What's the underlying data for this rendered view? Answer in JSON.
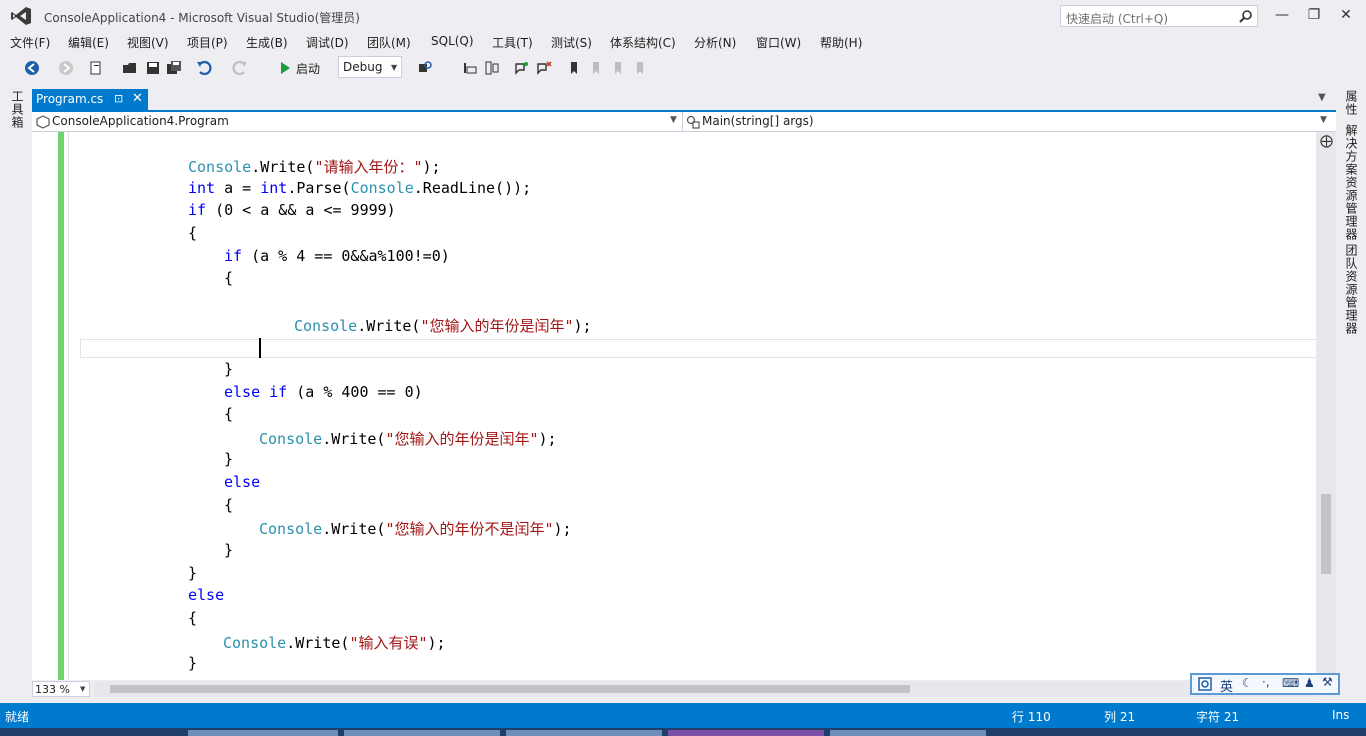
{
  "window": {
    "title": "ConsoleApplication4 - Microsoft Visual Studio(管理员)",
    "quick_launch_placeholder": "快速启动 (Ctrl+Q)"
  },
  "menu": [
    "文件(F)",
    "编辑(E)",
    "视图(V)",
    "项目(P)",
    "生成(B)",
    "调试(D)",
    "团队(M)",
    "SQL(Q)",
    "工具(T)",
    "测试(S)",
    "体系结构(C)",
    "分析(N)",
    "窗口(W)",
    "帮助(H)"
  ],
  "toolbar": {
    "start_label": "启动",
    "configuration": "Debug"
  },
  "side_panels": {
    "left": "工具箱",
    "right": [
      "属性",
      "解决方案资源管理器",
      "团队资源管理器"
    ]
  },
  "tabs": [
    {
      "label": "Program.cs",
      "active": true
    }
  ],
  "navbar": {
    "class": "ConsoleApplication4.Program",
    "member": "Main(string[] args)"
  },
  "code_lines": [
    [
      {
        "t": "Console",
        "c": "ty"
      },
      {
        "t": ".Write("
      },
      {
        "t": "\"请输入年份：\"",
        "c": "st"
      },
      {
        "t": ");"
      }
    ],
    [
      {
        "t": "int",
        "c": "kw"
      },
      {
        "t": " a = "
      },
      {
        "t": "int",
        "c": "kw"
      },
      {
        "t": ".Parse("
      },
      {
        "t": "Console",
        "c": "ty"
      },
      {
        "t": ".ReadLine());"
      }
    ],
    [
      {
        "t": "if",
        "c": "kw"
      },
      {
        "t": " (0 < a && a <= 9999)"
      }
    ],
    [
      {
        "t": "{"
      }
    ],
    [
      {
        "t": "if",
        "c": "kw"
      },
      {
        "t": " (a % 4 == 0&&a%100!=0)"
      }
    ],
    [
      {
        "t": "{"
      }
    ],
    [
      {
        "t": ""
      }
    ],
    [
      {
        "t": "Console",
        "c": "ty"
      },
      {
        "t": ".Write("
      },
      {
        "t": "\"您输入的年份是闰年\"",
        "c": "st"
      },
      {
        "t": ");"
      }
    ],
    [
      {
        "t": ""
      }
    ],
    [
      {
        "t": "}"
      }
    ],
    [
      {
        "t": "else",
        "c": "kw"
      },
      {
        "t": " "
      },
      {
        "t": "if",
        "c": "kw"
      },
      {
        "t": " (a % 400 == 0)"
      }
    ],
    [
      {
        "t": "{"
      }
    ],
    [
      {
        "t": "Console",
        "c": "ty"
      },
      {
        "t": ".Write("
      },
      {
        "t": "\"您输入的年份是闰年\"",
        "c": "st"
      },
      {
        "t": ");"
      }
    ],
    [
      {
        "t": "}"
      }
    ],
    [
      {
        "t": "else",
        "c": "kw"
      }
    ],
    [
      {
        "t": "{"
      }
    ],
    [
      {
        "t": "Console",
        "c": "ty"
      },
      {
        "t": ".Write("
      },
      {
        "t": "\"您输入的年份不是闰年\"",
        "c": "st"
      },
      {
        "t": ");"
      }
    ],
    [
      {
        "t": "}"
      }
    ],
    [
      {
        "t": "}"
      }
    ],
    [
      {
        "t": "else",
        "c": "kw"
      }
    ],
    [
      {
        "t": "{"
      }
    ],
    [
      {
        "t": "Console",
        "c": "ty"
      },
      {
        "t": ".Write("
      },
      {
        "t": "\"输入有误\"",
        "c": "st"
      },
      {
        "t": ");"
      }
    ],
    [
      {
        "t": "}"
      }
    ]
  ],
  "editor": {
    "zoom": "133 %"
  },
  "ime": {
    "language": "英"
  },
  "status": {
    "state": "就绪",
    "line": "行 110",
    "column": "列 21",
    "char": "字符 21",
    "mode": "Ins"
  },
  "colors": {
    "accent": "#007acc",
    "keyword": "#0000ff",
    "type": "#2b91af",
    "string": "#a31515",
    "change_bar": "#6fd46f"
  }
}
